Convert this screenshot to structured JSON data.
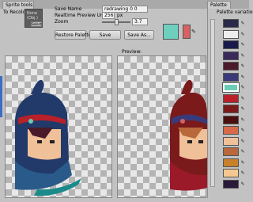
{
  "window": {
    "tab_main": "Sprite tools",
    "subtitle": "To Recolor",
    "tab_palette": "Palette"
  },
  "settings": {
    "save_name_label": "Save Name",
    "save_name_value": "redrawing 0 0",
    "realtime_label": "Realtime Preview Under",
    "realtime_value": "256",
    "realtime_unit": "px",
    "zoom_label": "Zoom",
    "zoom_value": "3.7",
    "zoom_fraction": 0.5,
    "none_label": "None",
    "none_sub": "(Obj.)",
    "select_label": "Select"
  },
  "buttons": {
    "restore": "Restore Palette",
    "save": "Save",
    "save_as": "Save As..."
  },
  "swatches": {
    "primary": "#6fcfbf",
    "secondary": "#d86262"
  },
  "preview": {
    "label": "Preview:"
  },
  "palette": {
    "title": "Palette variation",
    "colors": [
      "#2a2a4a",
      "#eeeeee",
      "#1a1a4a",
      "#3a2a5a",
      "#4a1a2a",
      "#3a3a7a",
      "#6acdb5",
      "#b8202a",
      "#7a1a1a",
      "#4a1010",
      "#d86a4a",
      "#f0c098",
      "#b8683a",
      "#c8802a",
      "#f4c890",
      "#2a1a3a"
    ],
    "selected_index": 6
  }
}
